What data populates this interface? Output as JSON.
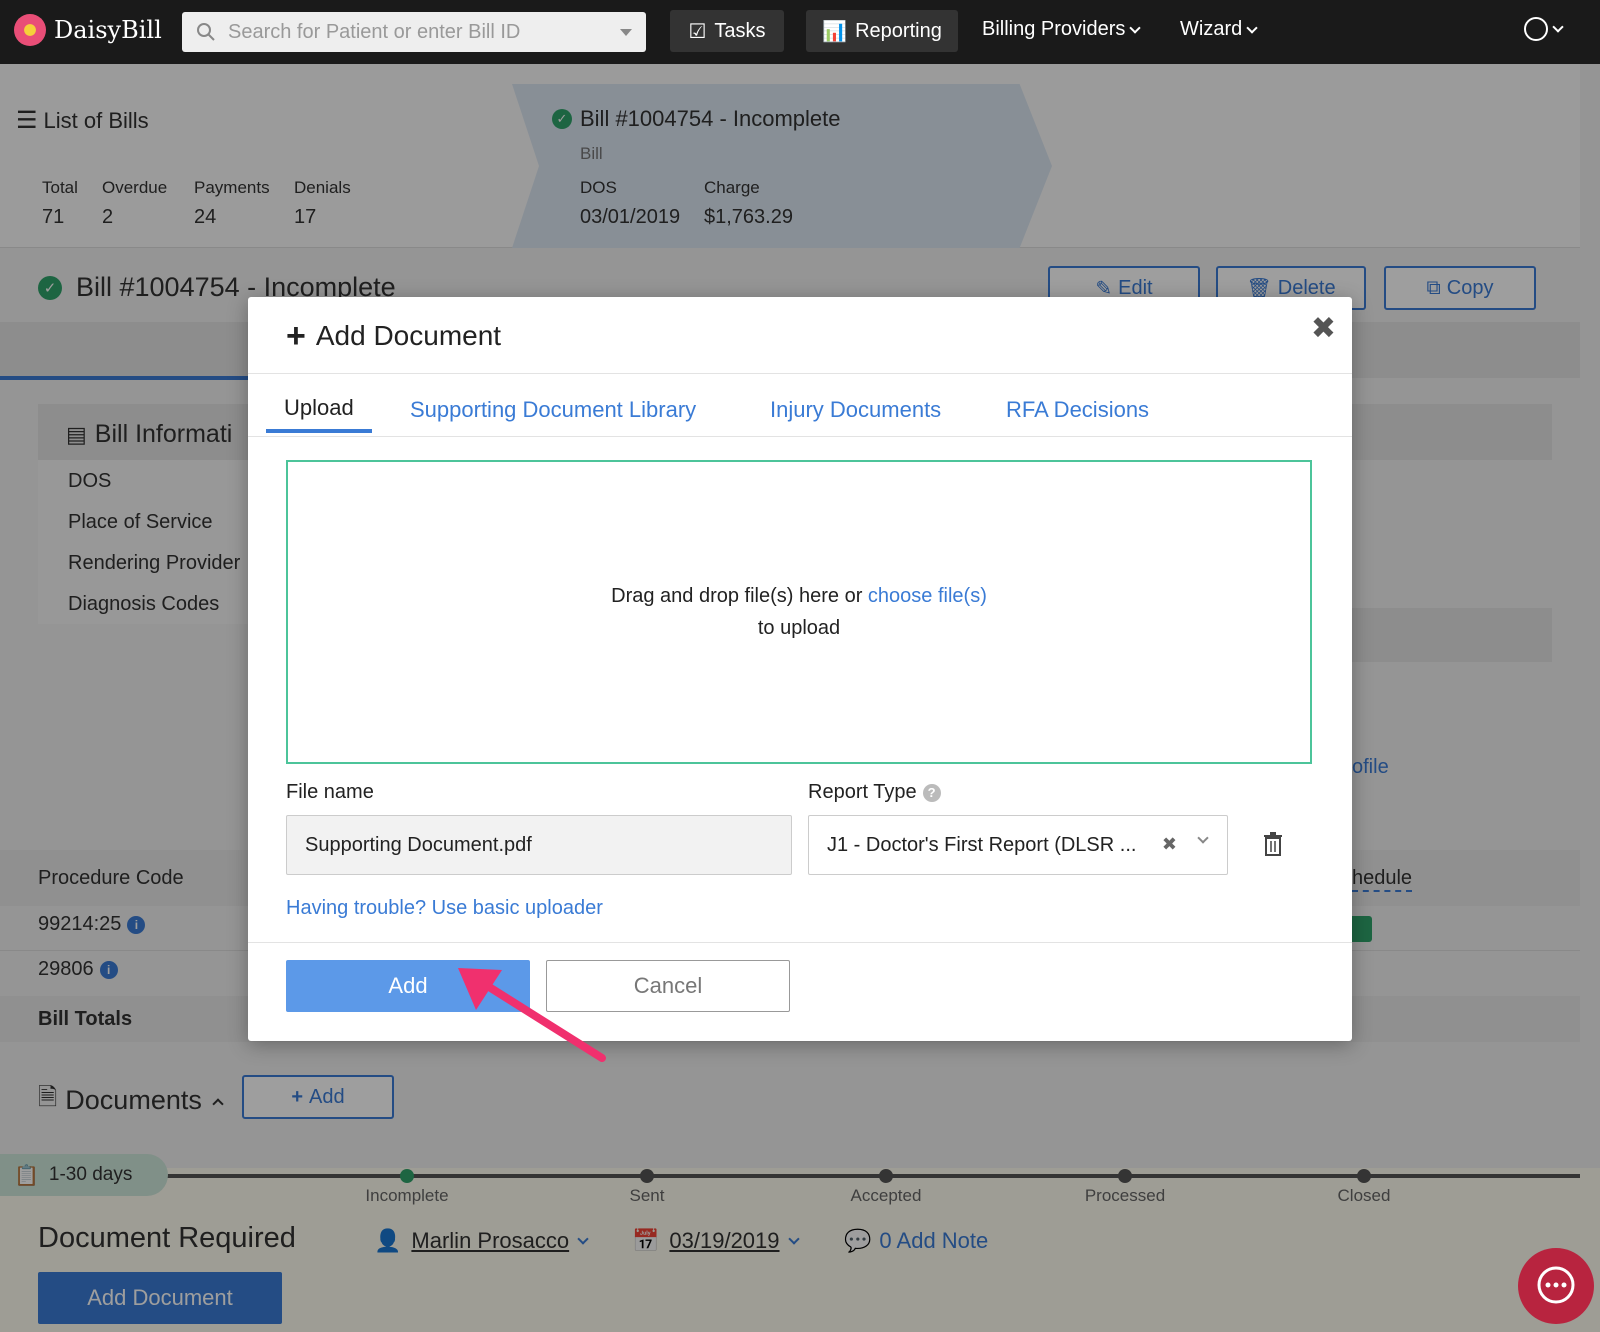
{
  "nav": {
    "brand": "DaisyBill",
    "search_placeholder": "Search for Patient or enter Bill ID",
    "tasks": "Tasks",
    "reporting": "Reporting",
    "billing_providers": "Billing Providers",
    "wizard": "Wizard"
  },
  "summary": {
    "list_title": "List of Bills",
    "stats": [
      {
        "label": "Total",
        "value": "71"
      },
      {
        "label": "Overdue",
        "value": "2"
      },
      {
        "label": "Payments",
        "value": "24"
      },
      {
        "label": "Denials",
        "value": "17"
      }
    ],
    "bill_title": "Bill #1004754 - Incomplete",
    "bill_sub": "Bill",
    "dos_label": "DOS",
    "dos_value": "03/01/2019",
    "charge_label": "Charge",
    "charge_value": "$1,763.29"
  },
  "bill_header": {
    "title": "Bill #1004754 - Incomplete",
    "edit": "Edit",
    "delete": "Delete",
    "copy": "Copy"
  },
  "bill_info": {
    "title": "Bill Informati",
    "rows": [
      "DOS",
      "Place of Service",
      "Rendering Provider",
      "Diagnosis Codes"
    ],
    "profile_link": "ofile",
    "schedule_header": "hedule"
  },
  "procedures": {
    "header": "Procedure Code",
    "codes": [
      "99214:25",
      "29806"
    ],
    "totals": "Bill Totals"
  },
  "documents": {
    "title": "Documents",
    "add": "Add"
  },
  "status": {
    "days": "1-30 days",
    "steps": [
      "Incomplete",
      "Sent",
      "Accepted",
      "Processed",
      "Closed"
    ],
    "required": "Document Required",
    "assignee": "Marlin Prosacco",
    "date": "03/19/2019",
    "note": "0 Add Note",
    "add_document": "Add Document"
  },
  "modal": {
    "title": "Add Document",
    "tabs": [
      "Upload",
      "Supporting Document Library",
      "Injury Documents",
      "RFA Decisions"
    ],
    "drop_text": "Drag and drop file(s) here or",
    "drop_link": "choose file(s)",
    "drop_text2": "to upload",
    "file_name_label": "File name",
    "file_name_value": "Supporting Document.pdf",
    "report_type_label": "Report Type",
    "report_type_value": "J1 - Doctor's First Report (DLSR ...",
    "basic_uploader": "Having trouble? Use basic uploader",
    "add_button": "Add",
    "cancel_button": "Cancel"
  },
  "colors": {
    "accent": "#3a7bd5",
    "primary_button": "#5c99e8",
    "dropzone_border": "#4cc49a",
    "annotation_arrow": "#f0306e"
  }
}
